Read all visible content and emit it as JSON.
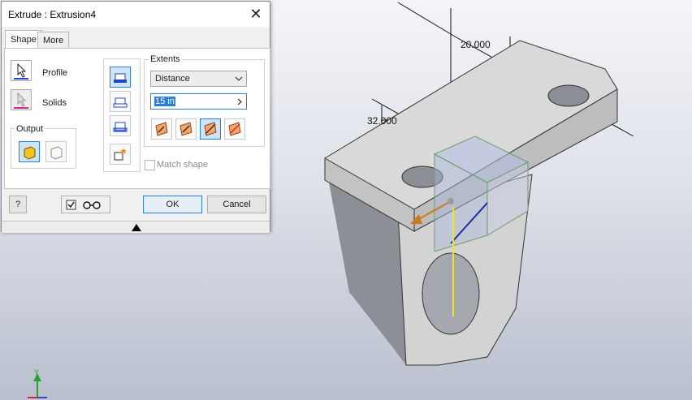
{
  "dialog": {
    "title": "Extrude : Extrusion4",
    "close_glyph": "✕",
    "tabs": [
      {
        "label": "Shape",
        "active": true
      },
      {
        "label": "More",
        "active": false
      }
    ],
    "profile_label": "Profile",
    "solids_label": "Solids",
    "output_label": "Output",
    "extents_label": "Extents",
    "extents_option": "Distance",
    "distance_value": "15 in",
    "match_shape_label": "Match shape",
    "match_shape_checked": false,
    "preview_checked": true,
    "ok_label": "OK",
    "cancel_label": "Cancel",
    "help_glyph": "?"
  },
  "viewport": {
    "dimension_top": "20.000",
    "dimension_left": "32.000",
    "axis_label": "Y"
  },
  "colors": {
    "accent": "#2a7fd4",
    "part_face": "#d6d6d6",
    "preview_box": "#aab7da",
    "arrow": "#c97a1d",
    "axis_yellow": "#f0e51a"
  },
  "icons": {
    "profile": "cursor-arrow-icon",
    "solids": "cursor-arrow-icon",
    "output_solid": "solid-cube-icon",
    "output_surface": "surface-cube-icon",
    "join": "join-icon",
    "cut": "cut-icon",
    "intersect": "intersect-icon",
    "new_solid": "new-solid-icon",
    "direction": [
      "direction-default-icon",
      "direction-flip-icon",
      "direction-symmetric-icon",
      "direction-asymmetric-icon"
    ],
    "help": "help-icon",
    "preview": "glasses-icon"
  }
}
